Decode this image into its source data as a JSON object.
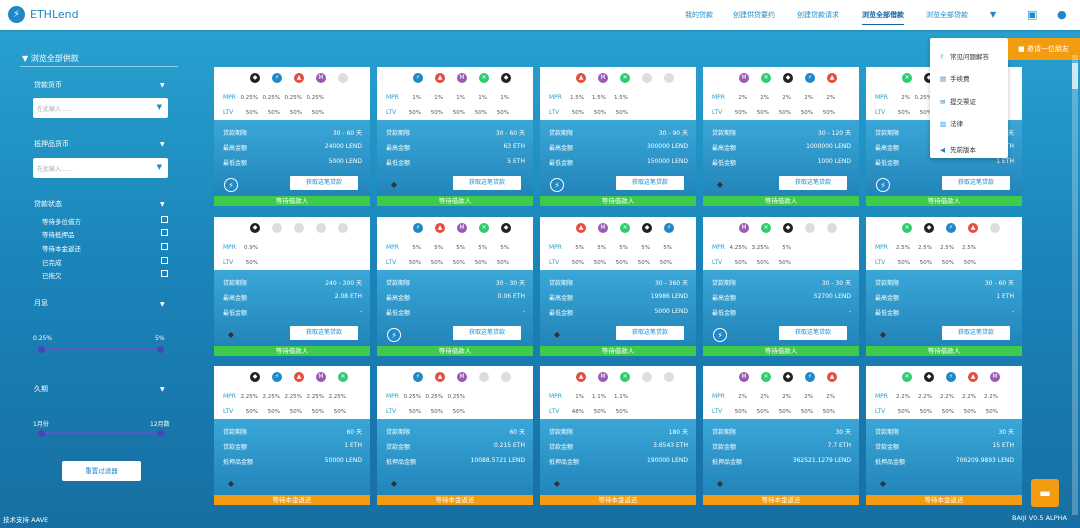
{
  "brand": "ETHLend",
  "nav": [
    "我的贷款",
    "创建供贷要约",
    "创建贷款请求",
    "浏览全部借款",
    "浏览全部贷款"
  ],
  "sidebar": {
    "title": "浏览全部供款",
    "loan_currency": "贷款货币",
    "placeholder1": "在此输入……",
    "collateral_currency": "抵押品货币",
    "placeholder2": "在此输入……",
    "loan_status": "贷款状态",
    "statuses": [
      "等待多位借方",
      "等待抵押品",
      "等待本金返还",
      "已完成",
      "已拖欠"
    ],
    "monthly_interest": "月息",
    "min_rate": "0.25%",
    "max_rate": "5%",
    "duration": "久期",
    "min_dur": "1月份",
    "max_dur": "12月数",
    "reset": "重置过滤器"
  },
  "footer": {
    "left": "技术支持 AAVE",
    "right": "BAIJI V0.5 ALPHA"
  },
  "menu": [
    "常见问题解答",
    "手续费",
    "提交票证",
    "法律",
    "先前版本"
  ],
  "invite": "邀请一位朋友",
  "labels": {
    "mpr": "MPR",
    "ltv": "LTV",
    "term": "贷款期限",
    "max": "最高金额",
    "min": "最低金额",
    "amount": "贷款金额",
    "collateral": "抵押品金额",
    "btn": "获取这笔贷款",
    "waiting": "等待借款人",
    "repay": "等待本金返还"
  },
  "cards": [
    {
      "mpr": [
        "0.25%",
        "0.25%",
        "0.25%",
        "0.25%",
        ""
      ],
      "ltv": [
        "50%",
        "50%",
        "50%",
        "50%",
        ""
      ],
      "term": "30 - 60 天",
      "v2": "24000 LEND",
      "v3": "5000 LEND",
      "status": "等待借款人"
    },
    {
      "mpr": [
        "1%",
        "1%",
        "1%",
        "1%",
        "1%"
      ],
      "ltv": [
        "50%",
        "50%",
        "50%",
        "50%",
        "50%"
      ],
      "term": "30 - 60 天",
      "v2": "63 ETH",
      "v3": "5 ETH",
      "status": "等待借款人"
    },
    {
      "mpr": [
        "1.5%",
        "1.5%",
        "1.5%",
        "",
        ""
      ],
      "ltv": [
        "50%",
        "50%",
        "50%",
        "",
        ""
      ],
      "term": "30 - 90 天",
      "v2": "300000 LEND",
      "v3": "150000 LEND",
      "status": "等待借款人"
    },
    {
      "mpr": [
        "2%",
        "2%",
        "2%",
        "2%",
        "2%"
      ],
      "ltv": [
        "50%",
        "50%",
        "50%",
        "50%",
        "50%"
      ],
      "term": "30 - 120 天",
      "v2": "1000000 LEND",
      "v3": "1000 LEND",
      "status": "等待借款人"
    },
    {
      "mpr": [
        "2%",
        "0.25%",
        "",
        "",
        ""
      ],
      "ltv": [
        "50%",
        "50%",
        "",
        "",
        ""
      ],
      "term": "30 - 60 天",
      "v2": "1 ETH",
      "v3": "1 ETH",
      "status": "等待借款人"
    },
    {
      "mpr": [
        "0.9%",
        "",
        "",
        "",
        ""
      ],
      "ltv": [
        "50%",
        "",
        "",
        "",
        ""
      ],
      "term": "240 - 300 天",
      "v2": "2.08 ETH",
      "v3": "-",
      "status": "等待借款人"
    },
    {
      "mpr": [
        "5%",
        "5%",
        "5%",
        "5%",
        "5%"
      ],
      "ltv": [
        "50%",
        "50%",
        "50%",
        "50%",
        "50%"
      ],
      "term": "30 - 30 天",
      "v2": "0.06 ETH",
      "v3": "-",
      "status": "等待借款人"
    },
    {
      "mpr": [
        "5%",
        "5%",
        "5%",
        "5%",
        "5%"
      ],
      "ltv": [
        "50%",
        "50%",
        "50%",
        "50%",
        "50%"
      ],
      "term": "30 - 360 天",
      "v2": "19986 LEND",
      "v3": "5000 LEND",
      "status": "等待借款人"
    },
    {
      "mpr": [
        "4.25%",
        "3.25%",
        "5%",
        "",
        ""
      ],
      "ltv": [
        "50%",
        "50%",
        "50%",
        "",
        ""
      ],
      "term": "30 - 30 天",
      "v2": "52700 LEND",
      "v3": "-",
      "status": "等待借款人"
    },
    {
      "mpr": [
        "2.5%",
        "2.5%",
        "2.5%",
        "2.5%",
        ""
      ],
      "ltv": [
        "50%",
        "50%",
        "50%",
        "50%",
        ""
      ],
      "term": "30 - 60 天",
      "v2": "1 ETH",
      "v3": "-",
      "status": "等待借款人"
    },
    {
      "mpr": [
        "2.25%",
        "2.25%",
        "2.25%",
        "2.25%",
        "2.25%"
      ],
      "ltv": [
        "50%",
        "50%",
        "50%",
        "50%",
        "50%"
      ],
      "term": "60 天",
      "v2": "1 ETH",
      "v3": "50000 LEND",
      "status": "等待本金返还"
    },
    {
      "mpr": [
        "0.25%",
        "0.25%",
        "0.25%",
        "",
        ""
      ],
      "ltv": [
        "50%",
        "50%",
        "50%",
        "",
        ""
      ],
      "term": "60 天",
      "v2": "0.215 ETH",
      "v3": "10088.5721 LEND",
      "status": "等待本金返还"
    },
    {
      "mpr": [
        "1%",
        "1.1%",
        "1.1%",
        "",
        ""
      ],
      "ltv": [
        "48%",
        "50%",
        "50%",
        "",
        ""
      ],
      "term": "180 天",
      "v2": "3.6543 ETH",
      "v3": "190000 LEND",
      "status": "等待本金返还"
    },
    {
      "mpr": [
        "2%",
        "2%",
        "2%",
        "2%",
        "2%"
      ],
      "ltv": [
        "50%",
        "50%",
        "50%",
        "50%",
        "50%"
      ],
      "term": "30 天",
      "v2": "7.7 ETH",
      "v3": "362521.1279 LEND",
      "status": "等待本金返还"
    },
    {
      "mpr": [
        "2.2%",
        "2.2%",
        "2.2%",
        "2.2%",
        "2.2%"
      ],
      "ltv": [
        "50%",
        "50%",
        "50%",
        "50%",
        "50%"
      ],
      "term": "30 天",
      "v2": "15 ETH",
      "v3": "706209.9893 LEND",
      "status": "等待本金返还"
    }
  ],
  "colors": {
    "accent": "#1e88c8",
    "green": "#3ecb4c",
    "orange": "#f39c12"
  }
}
